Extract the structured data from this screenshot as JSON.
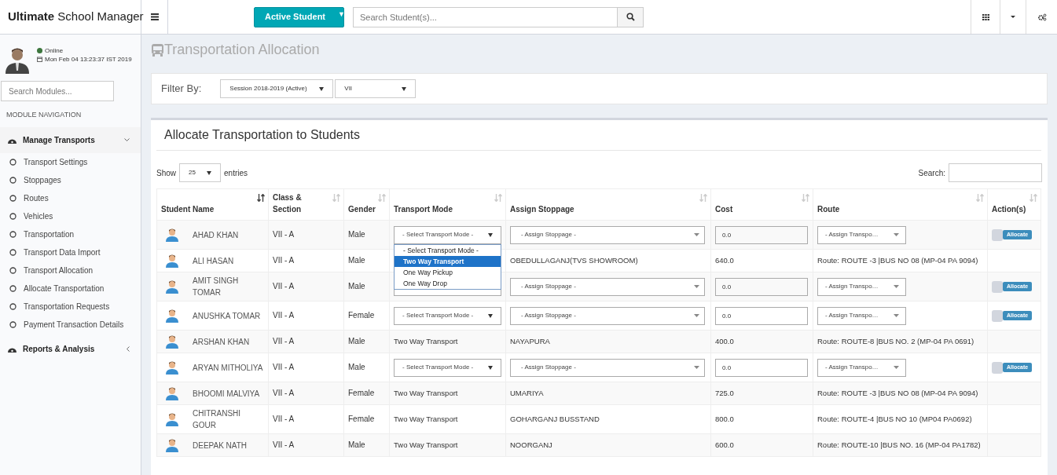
{
  "brand": {
    "bold": "Ultimate",
    "rest": "School Manager"
  },
  "top_button": {
    "label": "Active Student",
    "caret": "▼"
  },
  "search": {
    "placeholder": "Search Student(s)..."
  },
  "user": {
    "status": "Online",
    "datetime": "Mon Feb 04 13:23:37 IST 2019"
  },
  "module_search": {
    "placeholder": "Search Modules..."
  },
  "nav_heading": "MODULE NAVIGATION",
  "nav": [
    {
      "label": "Manage Transports",
      "expanded": true,
      "children": [
        {
          "label": "Transport Settings"
        },
        {
          "label": "Stoppages"
        },
        {
          "label": "Routes"
        },
        {
          "label": "Vehicles"
        },
        {
          "label": "Transportation"
        },
        {
          "label": "Transport Data Import"
        },
        {
          "label": "Transport Allocation"
        },
        {
          "label": "Allocate Transportation"
        },
        {
          "label": "Transportation Requests"
        },
        {
          "label": "Payment Transaction Details"
        }
      ]
    },
    {
      "label": "Reports & Analysis",
      "expanded": false
    }
  ],
  "page_title": "Transportation Allocation",
  "filter": {
    "label": "Filter By:",
    "session": "Session 2018-2019 (Active)",
    "class": "VII"
  },
  "panel_title": "Allocate Transportation to Students",
  "show": {
    "before": "Show",
    "value": "25",
    "after": "entries"
  },
  "table_search": "Search:",
  "columns": [
    {
      "label": "Student Name",
      "sorted": true
    },
    {
      "label": "Class & Section",
      "sorted": false
    },
    {
      "label": "Gender",
      "sorted": false
    },
    {
      "label": "Transport Mode",
      "sorted": false
    },
    {
      "label": "Assign Stoppage",
      "sorted": false
    },
    {
      "label": "Cost",
      "sorted": false
    },
    {
      "label": "Route",
      "sorted": false
    },
    {
      "label": "Action(s)",
      "sorted": false
    }
  ],
  "rows": [
    {
      "kind": "editable",
      "name": "AHAD KHAN",
      "class": "VII - A",
      "gender": "Male",
      "mode": "- Select Transport Mode -",
      "stoppage": "- Assign Stoppage -",
      "cost": "0.0",
      "route": "- Assign Transpo…",
      "checked": false,
      "action": "Allocate",
      "dropdown": [
        {
          "label": "- Select Transport Mode -",
          "selected": false
        },
        {
          "label": "Two Way Transport",
          "selected": true
        },
        {
          "label": "One Way Pickup",
          "selected": false
        },
        {
          "label": "One Way Drop",
          "selected": false
        }
      ]
    },
    {
      "kind": "assigned",
      "name": "ALI HASAN",
      "class": "VII - A",
      "gender": "Male",
      "stoppage": "OBEDULLAGANJ(TVS SHOWROOM)",
      "cost": "640.0",
      "route": "Route: ROUTE -3 |BUS NO 08 (MP-04 PA 9094)"
    },
    {
      "kind": "editable",
      "name": "AMIT SINGH TOMAR",
      "class": "VII - A",
      "gender": "Male",
      "stoppage": "- Assign Stoppage -",
      "cost": "0.0",
      "route": "- Assign Transpo…",
      "checked": false,
      "action": "Allocate"
    },
    {
      "kind": "editable",
      "name": "ANUSHKA TOMAR",
      "class": "VII - A",
      "gender": "Female",
      "mode": "- Select Transport Mode -",
      "stoppage": "- Assign Stoppage -",
      "cost": "0.0",
      "route": "- Assign Transpo…",
      "checked": false,
      "action": "Allocate"
    },
    {
      "kind": "assigned",
      "name": "ARSHAN KHAN",
      "class": "VII - A",
      "gender": "Male",
      "mode": "Two Way Transport",
      "stoppage": "NAYAPURA",
      "cost": "400.0",
      "route": "Route: ROUTE-8 |BUS NO. 2 (MP-04 PA 0691)"
    },
    {
      "kind": "editable",
      "name": "ARYAN MITHOLIYA",
      "class": "VII - A",
      "gender": "Male",
      "mode": "- Select Transport Mode -",
      "stoppage": "- Assign Stoppage -",
      "cost": "0.0",
      "route": "- Assign Transpo…",
      "checked": false,
      "action": "Allocate"
    },
    {
      "kind": "assigned",
      "name": "BHOOMI MALVIYA",
      "class": "VII - A",
      "gender": "Female",
      "mode": "Two Way Transport",
      "stoppage": "UMARIYA",
      "cost": "725.0",
      "route": "Route: ROUTE -3 |BUS NO 08 (MP-04 PA 9094)"
    },
    {
      "kind": "assigned",
      "name": "CHITRANSHI GOUR",
      "class": "VII - A",
      "gender": "Female",
      "mode": "Two Way Transport",
      "stoppage": "GOHARGANJ BUSSTAND",
      "cost": "800.0",
      "route": "Route: ROUTE-4 |BUS NO 10 (MP04 PA0692)"
    },
    {
      "kind": "assigned",
      "name": "DEEPAK NATH",
      "class": "VII - A",
      "gender": "Male",
      "mode": "Two Way Transport",
      "stoppage": "NOORGANJ",
      "cost": "600.0",
      "route": "Route: ROUTE-10 |BUS NO. 16 (MP-04 PA1782)"
    }
  ]
}
